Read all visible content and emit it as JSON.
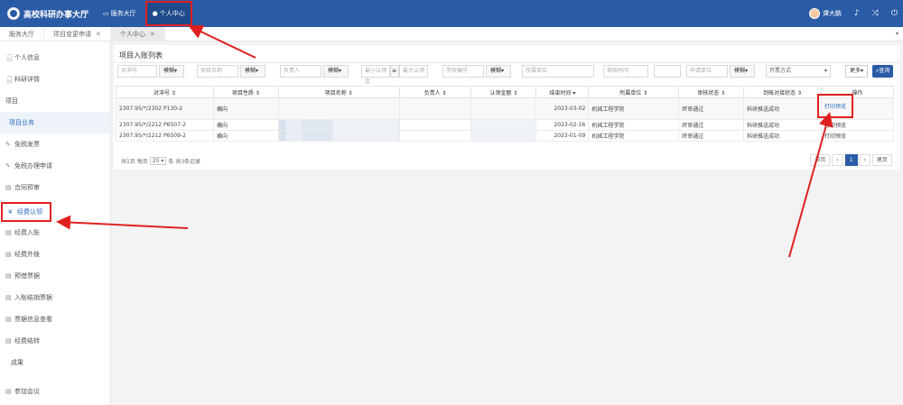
{
  "app": {
    "title": "高校科研办事大厅"
  },
  "topnav": {
    "service_hall": "服务大厅",
    "personal_center": "个人中心"
  },
  "user": {
    "name": "谭大鹏"
  },
  "tabs": [
    "服务大厅",
    "项目变更申请",
    "个人中心"
  ],
  "sidebar": {
    "items": [
      {
        "label": "个人信息",
        "icon": "user-icon"
      },
      {
        "label": "科研详情",
        "icon": "user-icon"
      },
      {
        "label": "项目"
      },
      {
        "label": "项目业务"
      },
      {
        "label": "免税发票",
        "icon": "tax-icon"
      },
      {
        "label": "免税办理申请",
        "icon": "tax-icon"
      },
      {
        "label": "合同预审",
        "icon": "doc-icon"
      },
      {
        "label": "经费认领",
        "icon": "yen-icon"
      },
      {
        "label": "经费入账",
        "icon": "doc-icon"
      },
      {
        "label": "经费外拨",
        "icon": "doc-icon"
      },
      {
        "label": "预借票据",
        "icon": "doc-icon"
      },
      {
        "label": "入账结销票据",
        "icon": "doc-icon"
      },
      {
        "label": "票据信息查看",
        "icon": "doc-icon"
      },
      {
        "label": "经费结转",
        "icon": "doc-icon"
      },
      {
        "label": "成果"
      },
      {
        "label": "参加会议",
        "icon": "doc-icon"
      }
    ]
  },
  "panel": {
    "title": "项目入账列表"
  },
  "filters": {
    "account_no": "对冲号",
    "fuzzy": "模糊",
    "project_name": "项目名称",
    "leader": "负责人",
    "min_amount": "最小认领金",
    "max_amount": "最大认领",
    "school_no": "学校编号",
    "unit": "所属单位",
    "review_time": "审核时间",
    "department": "申请单位",
    "invoice_type": "开票方式",
    "more": "更多",
    "query": "查询"
  },
  "table": {
    "headers": [
      "对冲号",
      "项目性质",
      "项目名称",
      "负责人",
      "认领金额",
      "结束时间",
      "所属单位",
      "审核状态",
      "到帐对接状态",
      "操作"
    ],
    "rows": [
      {
        "no": "2307.95/*/2302 P130-2",
        "type": "横向",
        "end": "2023-03-02",
        "unit": "机械工程学院",
        "review": "终审通过",
        "status": "科研推送成功",
        "op": "打印预览"
      },
      {
        "no": "2307.95/*/2212 P6507-2",
        "type": "横向",
        "end": "2023-02-16",
        "unit": "机械工程学院",
        "review": "终审通过",
        "status": "科研推送成功",
        "op": "打印预览"
      },
      {
        "no": "2307.95/*/2212 P6509-2",
        "type": "横向",
        "end": "2023-01-09",
        "unit": "机械工程学院",
        "review": "终审通过",
        "status": "科研推送成功",
        "op": "打印预览"
      }
    ]
  },
  "pager": {
    "info_prefix": "共1页 每页",
    "page_size": "20",
    "info_suffix": "条 共3条记录",
    "first": "首页",
    "prev": "‹",
    "current": "1",
    "next": "›",
    "last": "尾页"
  },
  "colors": {
    "brand": "#2a5ba6",
    "highlight": "#e02020",
    "link": "#2a6cc0"
  }
}
